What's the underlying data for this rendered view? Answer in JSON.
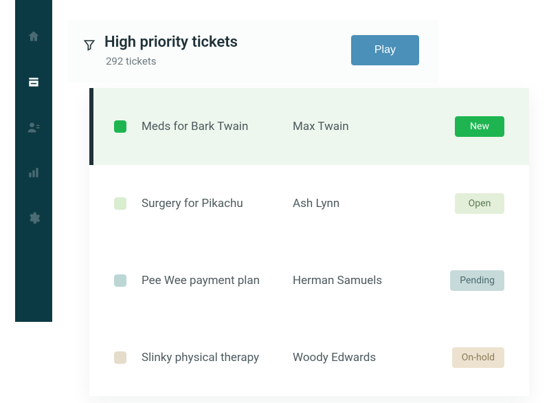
{
  "sidebar": {
    "items": [
      {
        "name": "home"
      },
      {
        "name": "tickets"
      },
      {
        "name": "contacts"
      },
      {
        "name": "reports"
      },
      {
        "name": "settings"
      }
    ],
    "activeIndex": 1
  },
  "header": {
    "title": "High priority tickets",
    "subtitle": "292 tickets",
    "play_label": "Play"
  },
  "colors": {
    "chk_new": "#1eb551",
    "chk_open": "#d9edcf",
    "chk_pending": "#bcd6d6",
    "chk_hold": "#e5dccb",
    "badge_new_bg": "#1eb551",
    "badge_new_fg": "#ffffff",
    "badge_open_bg": "#e3efd9",
    "badge_open_fg": "#5b7a55",
    "badge_pending_bg": "#c7dada",
    "badge_pending_fg": "#4c6c6f",
    "badge_hold_bg": "#ece2cf",
    "badge_hold_fg": "#8a7b56"
  },
  "tickets": [
    {
      "subject": "Meds for Bark Twain",
      "requester": "Max Twain",
      "status": "New",
      "chkColorKey": "chk_new",
      "badgeBgKey": "badge_new_bg",
      "badgeFgKey": "badge_new_fg",
      "selected": true
    },
    {
      "subject": "Surgery for Pikachu",
      "requester": "Ash Lynn",
      "status": "Open",
      "chkColorKey": "chk_open",
      "badgeBgKey": "badge_open_bg",
      "badgeFgKey": "badge_open_fg",
      "selected": false
    },
    {
      "subject": "Pee Wee payment plan",
      "requester": "Herman Samuels",
      "status": "Pending",
      "chkColorKey": "chk_pending",
      "badgeBgKey": "badge_pending_bg",
      "badgeFgKey": "badge_pending_fg",
      "selected": false
    },
    {
      "subject": "Slinky physical therapy",
      "requester": "Woody Edwards",
      "status": "On-hold",
      "chkColorKey": "chk_hold",
      "badgeBgKey": "badge_hold_bg",
      "badgeFgKey": "badge_hold_fg",
      "selected": false
    }
  ]
}
